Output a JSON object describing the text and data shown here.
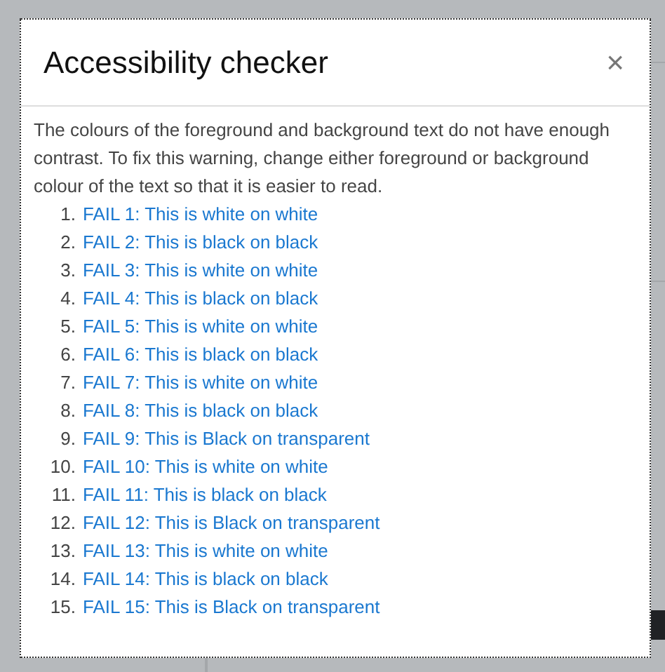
{
  "dialog": {
    "title": "Accessibility checker",
    "close": "×",
    "message": "The colours of the foreground and background text do not have enough contrast. To fix this warning, change either foreground or background colour of the text so that it is easier to read.",
    "issues": [
      {
        "number": "1.",
        "text": "FAIL 1: This is white on white"
      },
      {
        "number": "2.",
        "text": "FAIL 2: This is black on black"
      },
      {
        "number": "3.",
        "text": "FAIL 3: This is white on white"
      },
      {
        "number": "4.",
        "text": "FAIL 4: This is black on black"
      },
      {
        "number": "5.",
        "text": "FAIL 5: This is white on white"
      },
      {
        "number": "6.",
        "text": "FAIL 6: This is black on black"
      },
      {
        "number": "7.",
        "text": "FAIL 7: This is white on white"
      },
      {
        "number": "8.",
        "text": "FAIL 8: This is black on black"
      },
      {
        "number": "9.",
        "text": "FAIL 9: This is Black on transparent"
      },
      {
        "number": "10.",
        "text": "FAIL 10: This is white on white"
      },
      {
        "number": "11.",
        "text": "FAIL 11: This is black on black"
      },
      {
        "number": "12.",
        "text": "FAIL 12: This is Black on transparent"
      },
      {
        "number": "13.",
        "text": "FAIL 13: This is white on white"
      },
      {
        "number": "14.",
        "text": "FAIL 14: This is black on black"
      },
      {
        "number": "15.",
        "text": "FAIL 15: This is Black on transparent"
      }
    ]
  }
}
